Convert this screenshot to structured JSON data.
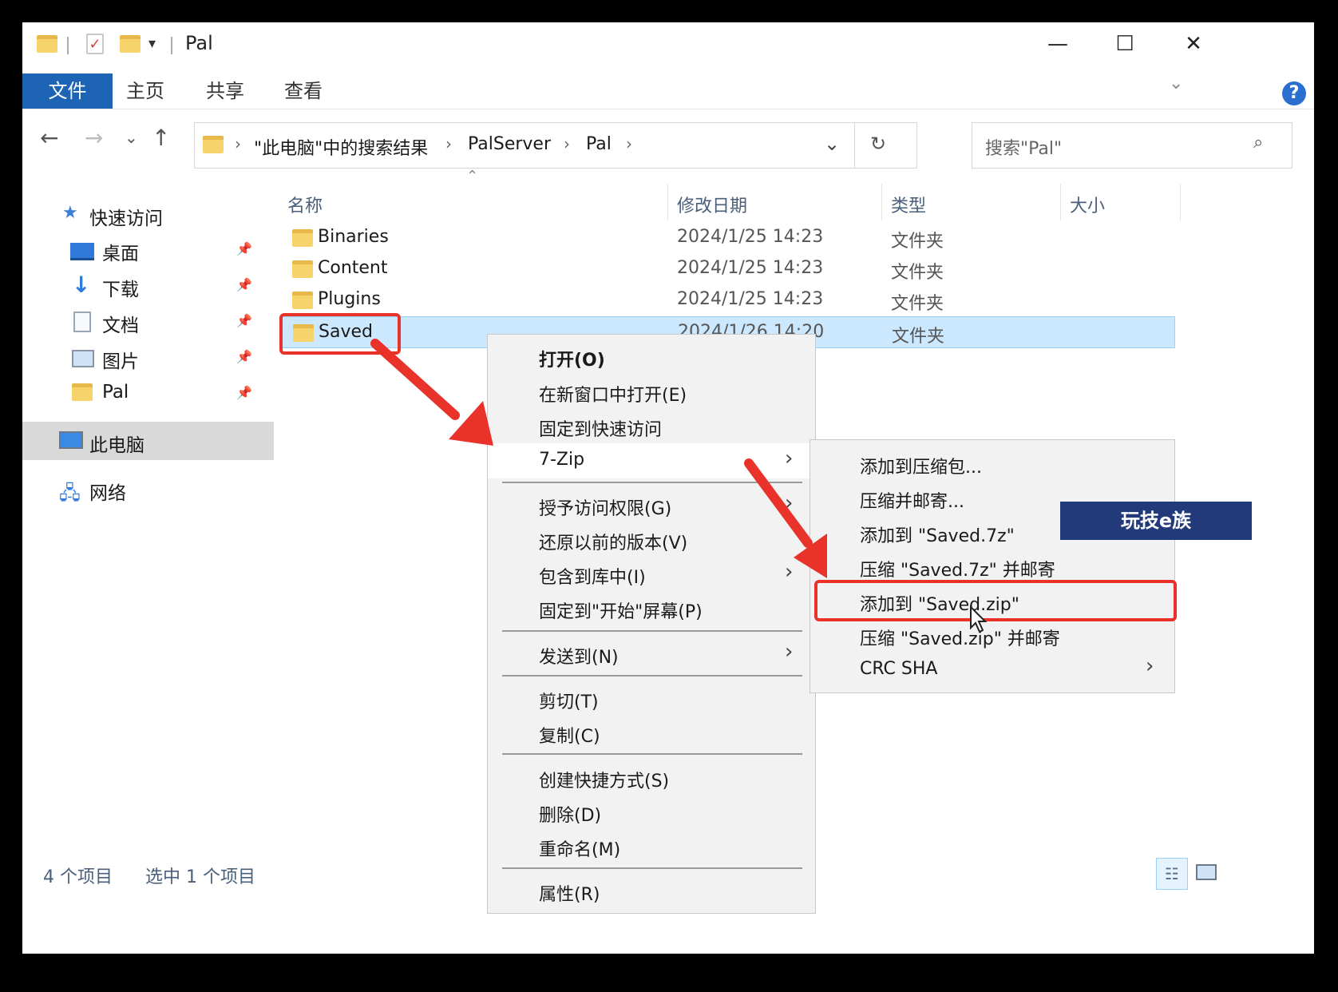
{
  "window": {
    "title": "Pal",
    "minimize_icon": "minimize-icon",
    "maximize_icon": "maximize-icon",
    "close_icon": "close-icon"
  },
  "ribbon": {
    "tabs": [
      "文件",
      "主页",
      "共享",
      "查看"
    ]
  },
  "address": {
    "crumbs": [
      "\"此电脑\"中的搜索结果",
      "PalServer",
      "Pal"
    ],
    "search_placeholder": "搜索\"Pal\""
  },
  "sidebar": {
    "quick_access": "快速访问",
    "items": [
      "桌面",
      "下载",
      "文档",
      "图片",
      "Pal"
    ],
    "this_pc": "此电脑",
    "network": "网络"
  },
  "columns": [
    "名称",
    "修改日期",
    "类型",
    "大小"
  ],
  "files": [
    {
      "name": "Binaries",
      "date": "2024/1/25 14:23",
      "type": "文件夹"
    },
    {
      "name": "Content",
      "date": "2024/1/25 14:23",
      "type": "文件夹"
    },
    {
      "name": "Plugins",
      "date": "2024/1/25 14:23",
      "type": "文件夹"
    },
    {
      "name": "Saved",
      "date": "2024/1/26 14:20",
      "type": "文件夹"
    }
  ],
  "context_menu": {
    "open": "打开(O)",
    "open_new_window": "在新窗口中打开(E)",
    "pin_quick": "固定到快速访问",
    "seven_zip": "7-Zip",
    "grant_access": "授予访问权限(G)",
    "restore": "还原以前的版本(V)",
    "include_library": "包含到库中(I)",
    "pin_start": "固定到\"开始\"屏幕(P)",
    "send_to": "发送到(N)",
    "cut": "剪切(T)",
    "copy": "复制(C)",
    "create_shortcut": "创建快捷方式(S)",
    "delete": "删除(D)",
    "rename": "重命名(M)",
    "properties": "属性(R)"
  },
  "submenu": {
    "items": [
      "添加到压缩包...",
      "压缩并邮寄...",
      "添加到 \"Saved.7z\"",
      "压缩 \"Saved.7z\" 并邮寄",
      "添加到 \"Saved.zip\"",
      "压缩 \"Saved.zip\" 并邮寄",
      "CRC SHA"
    ]
  },
  "status": {
    "count": "4 个项目",
    "selected": "选中 1 个项目"
  },
  "watermark": "玩技e族",
  "colors": {
    "accent": "#1e64b4",
    "highlight": "#e8322a",
    "selection": "#cce8ff"
  }
}
